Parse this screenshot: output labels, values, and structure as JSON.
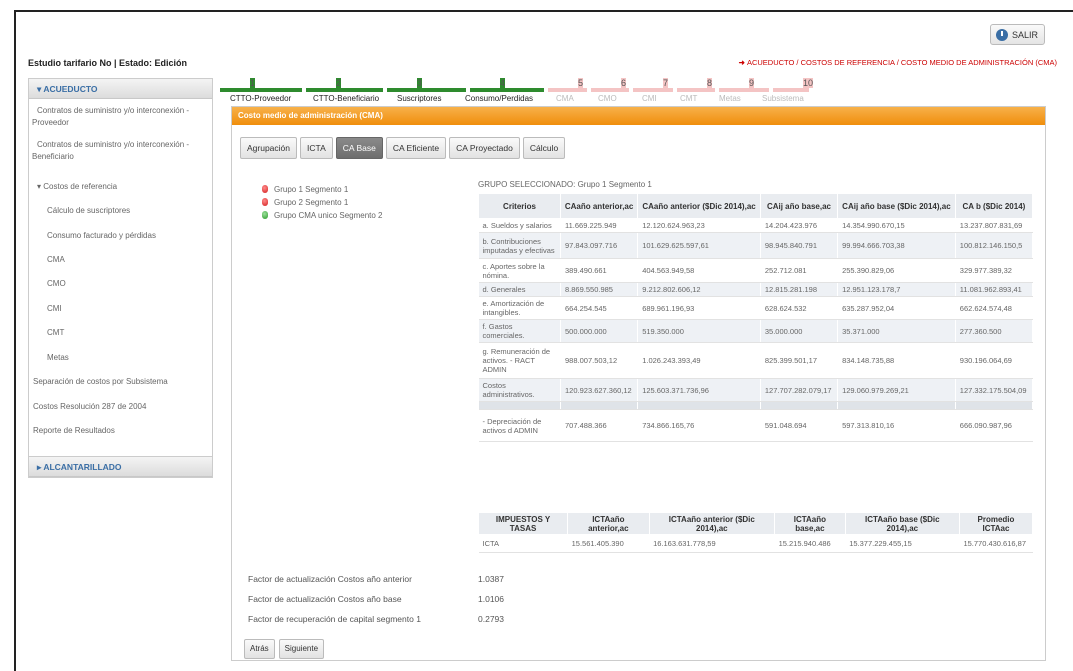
{
  "header": {
    "estudio": "Estudio tarifario No    | Estado: Edición",
    "salir": "SALIR",
    "breadcrumb": "Acueducto / Costos de referencia / Costo medio de administración (CMA)"
  },
  "sidebar": {
    "acueducto": "ACUEDUCTO",
    "alcantarillado": "ALCANTARILLADO",
    "items": [
      "Contratos de suministro y/o interconexión -",
      "Proveedor",
      "Contratos de suministro y/o interconexión -",
      "Beneficiario",
      "Costos de referencia",
      "Cálculo de suscriptores",
      "Consumo facturado y pérdidas",
      "CMA",
      "CMO",
      "CMI",
      "CMT",
      "Metas",
      "Separación de costos por Subsistema",
      "Costos Resolución 287 de 2004",
      "Reporte de Resultados"
    ]
  },
  "steps": [
    {
      "num": "1",
      "label": "CTTO-Proveedor",
      "active": true
    },
    {
      "num": "2",
      "label": "CTTO-Beneficiario",
      "active": true
    },
    {
      "num": "3",
      "label": "Suscriptores",
      "active": true
    },
    {
      "num": "4",
      "label": "Consumo/Perdidas",
      "active": true
    },
    {
      "num": "5",
      "label": "CMA",
      "active": false
    },
    {
      "num": "6",
      "label": "CMO",
      "active": false
    },
    {
      "num": "7",
      "label": "CMI",
      "active": false
    },
    {
      "num": "8",
      "label": "CMT",
      "active": false
    },
    {
      "num": "9",
      "label": "Metas",
      "active": false
    },
    {
      "num": "10",
      "label": "Subsistema",
      "active": false
    }
  ],
  "main": {
    "title": "Costo medio de administración (CMA)",
    "tabs": [
      "Agrupación",
      "ICTA",
      "CA Base",
      "CA Eficiente",
      "CA Proyectado",
      "Cálculo"
    ],
    "selected_tab": "CA Base",
    "groups": [
      {
        "label": "Grupo 1 Segmento 1",
        "color": "red"
      },
      {
        "label": "Grupo 2 Segmento 1",
        "color": "red"
      },
      {
        "label": "Grupo CMA unico Segmento 2",
        "color": "green"
      }
    ],
    "grupo_seleccionado": "GRUPO SELECCIONADO: Grupo 1 Segmento 1"
  },
  "table": {
    "headers": [
      "Criterios",
      "CAaño anterior,ac",
      "CAaño anterior ($Dic 2014),ac",
      "CAij año base,ac",
      "CAij año base ($Dic 2014),ac",
      "CA b ($Dic 2014)"
    ],
    "rows": [
      [
        "a. Sueldos y salarios",
        "11.669.225.949",
        "12.120.624.963,23",
        "14.204.423.976",
        "14.354.990.670,15",
        "13.237.807.831,69"
      ],
      [
        "b. Contribuciones imputadas y efectivas",
        "97.843.097.716",
        "101.629.625.597,61",
        "98.945.840.791",
        "99.994.666.703,38",
        "100.812.146.150,5"
      ],
      [
        "c. Aportes sobre la nómina.",
        "389.490.661",
        "404.563.949,58",
        "252.712.081",
        "255.390.829,06",
        "329.977.389,32"
      ],
      [
        "d. Generales",
        "8.869.550.985",
        "9.212.802.606,12",
        "12.815.281.198",
        "12.951.123.178,7",
        "11.081.962.893,41"
      ],
      [
        "e. Amortización de intangibles.",
        "664.254.545",
        "689.961.196,93",
        "628.624.532",
        "635.287.952,04",
        "662.624.574,48"
      ],
      [
        "f. Gastos comerciales.",
        "500.000.000",
        "519.350.000",
        "35.000.000",
        "35.371.000",
        "277.360.500"
      ],
      [
        "g. Remuneración de activos. - RACT ADMIN",
        "988.007.503,12",
        "1.026.243.393,49",
        "825.399.501,17",
        "834.148.735,88",
        "930.196.064,69"
      ],
      [
        "Costos administrativos.",
        "120.923.627.360,12",
        "125.603.371.736,96",
        "127.707.282.079,17",
        "129.060.979.269,21",
        "127.332.175.504,09"
      ]
    ],
    "extra_row": [
      "- Depreciación de activos d ADMIN",
      "707.488.366",
      "734.866.165,76",
      "591.048.694",
      "597.313.810,16",
      "666.090.987,96"
    ]
  },
  "table2": {
    "headers": [
      "IMPUESTOS Y TASAS",
      "ICTAaño anterior,ac",
      "ICTAaño anterior ($Dic 2014),ac",
      "ICTAaño base,ac",
      "ICTAaño base ($Dic 2014),ac",
      "Promedio ICTAac"
    ],
    "row": [
      "ICTA",
      "15.561.405.390",
      "16.163.631.778,59",
      "15.215.940.486",
      "15.377.229.455,15",
      "15.770.430.616,87"
    ]
  },
  "factors": [
    {
      "label": "Factor de actualización Costos año anterior",
      "value": "1.0387"
    },
    {
      "label": "Factor de actualización Costos año base",
      "value": "1.0106"
    },
    {
      "label": "Factor de recuperación de capital segmento 1",
      "value": "0.2793"
    }
  ],
  "buttons": {
    "atras": "Atrás",
    "siguiente": "Siguiente"
  }
}
